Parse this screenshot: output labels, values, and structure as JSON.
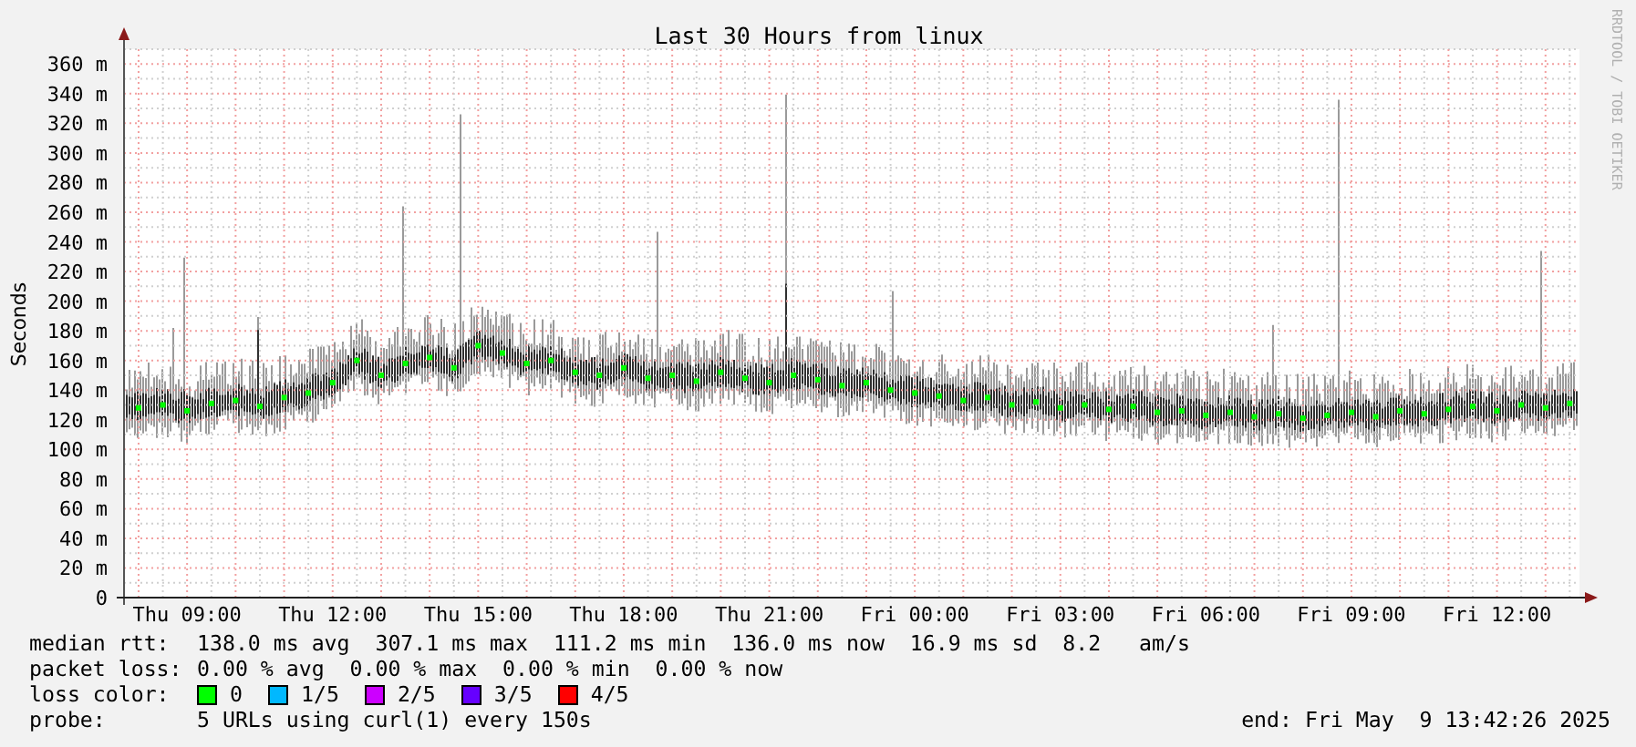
{
  "graph": {
    "side_text": "RRDTOOL / TOBI OETIKER",
    "chart_data": {
      "type": "scatter",
      "title": "Last 30 Hours from linux",
      "ylabel": "Seconds",
      "categories": [
        null,
        null,
        "Thu 09:00",
        null,
        null,
        null,
        null,
        null,
        "Thu 12:00",
        null,
        null,
        null,
        null,
        null,
        "Thu 15:00",
        null,
        null,
        null,
        null,
        null,
        "Thu 18:00",
        null,
        null,
        null,
        null,
        null,
        "Thu 21:00",
        null,
        null,
        null,
        null,
        null,
        "Fri 00:00",
        null,
        null,
        null,
        null,
        null,
        "Fri 03:00",
        null,
        null,
        null,
        null,
        null,
        "Fri 06:00",
        null,
        null,
        null,
        null,
        null,
        "Fri 09:00",
        null,
        null,
        null,
        null,
        null,
        "Fri 12:00",
        null,
        null,
        null
      ],
      "series": [
        {
          "color": "#00ff00",
          "values": [
            128,
            130,
            126,
            131,
            133,
            129,
            135,
            138,
            145,
            160,
            150,
            158,
            162,
            155,
            170,
            165,
            158,
            160,
            152,
            150,
            155,
            148,
            150,
            146,
            152,
            148,
            145,
            150,
            147,
            143,
            145,
            140,
            138,
            136,
            133,
            135,
            130,
            132,
            128,
            130,
            127,
            129,
            125,
            126,
            123,
            125,
            122,
            124,
            121,
            123,
            125,
            122,
            126,
            124,
            127,
            129,
            126,
            130,
            128,
            131
          ]
        }
      ],
      "grid": true,
      "ylim": [
        0,
        370
      ],
      "yticks": [
        {
          "value": 0,
          "label": "0"
        },
        {
          "value": 20,
          "label": "20 m"
        },
        {
          "value": 40,
          "label": "40 m"
        },
        {
          "value": 60,
          "label": "60 m"
        },
        {
          "value": 80,
          "label": "80 m"
        },
        {
          "value": 100,
          "label": "100 m"
        },
        {
          "value": 120,
          "label": "120 m"
        },
        {
          "value": 140,
          "label": "140 m"
        },
        {
          "value": 160,
          "label": "160 m"
        },
        {
          "value": 180,
          "label": "180 m"
        },
        {
          "value": 200,
          "label": "200 m"
        },
        {
          "value": 220,
          "label": "220 m"
        },
        {
          "value": 240,
          "label": "240 m"
        },
        {
          "value": 260,
          "label": "260 m"
        },
        {
          "value": 280,
          "label": "280 m"
        },
        {
          "value": 300,
          "label": "300 m"
        },
        {
          "value": 320,
          "label": "320 m"
        },
        {
          "value": 340,
          "label": "340 m"
        },
        {
          "value": 360,
          "label": "360 m"
        }
      ]
    }
  },
  "legend": {
    "rows": [
      {
        "label": "median rtt:",
        "value": "138.0 ms avg  307.1 ms max  111.2 ms min  136.0 ms now  16.9 ms sd  8.2   am/s"
      },
      {
        "label": "packet loss:",
        "value": "0.00 % avg  0.00 % max  0.00 % min  0.00 % now"
      }
    ],
    "loss_color": {
      "label": "loss color:",
      "items": [
        {
          "label": "0",
          "color": "#00ff00"
        },
        {
          "label": "1/5",
          "color": "#00b8ff"
        },
        {
          "label": "2/5",
          "color": "#cc00ff"
        },
        {
          "label": "3/5",
          "color": "#6600ff"
        },
        {
          "label": "4/5",
          "color": "#ff0000"
        }
      ]
    },
    "probe": {
      "label": "probe:",
      "value": "5 URLs using curl(1) every 150s"
    },
    "end": "end: Fri May  9 13:42:26 2025"
  }
}
